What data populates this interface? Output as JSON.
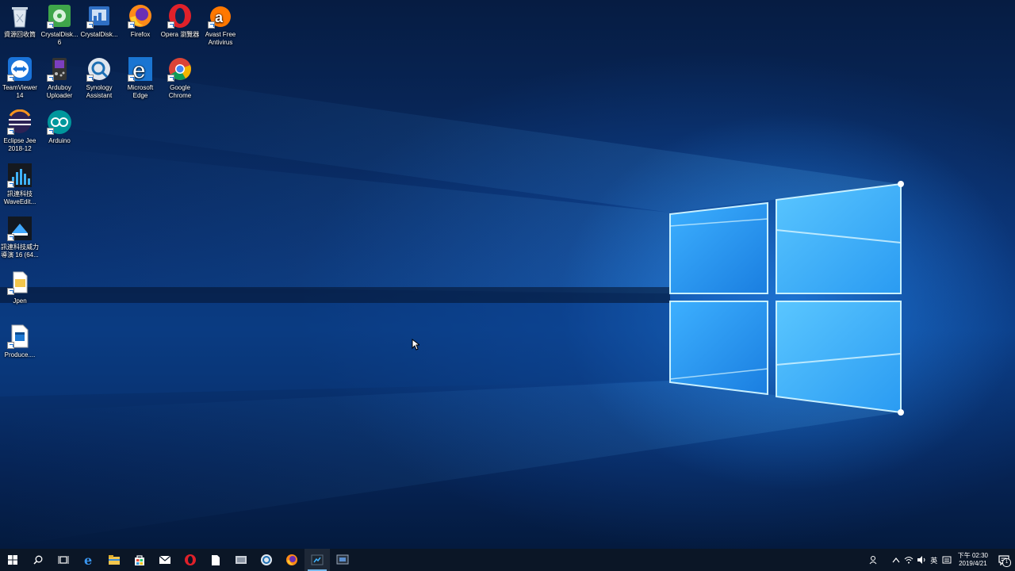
{
  "desktop": {
    "icons": [
      {
        "label": "資源回收筒",
        "icon": "recycle-bin-icon"
      },
      {
        "label": "CrystalDisk... 6",
        "icon": "crystaldiskinfo-icon"
      },
      {
        "label": "CrystalDisk...",
        "icon": "crystaldiskmark-icon"
      },
      {
        "label": "Firefox",
        "icon": "firefox-icon"
      },
      {
        "label": "Opera 瀏覽器",
        "icon": "opera-icon"
      },
      {
        "label": "Avast Free Antivirus",
        "icon": "avast-icon"
      },
      {
        "label": "TeamViewer 14",
        "icon": "teamviewer-icon"
      },
      {
        "label": "Arduboy Uploader",
        "icon": "arduboy-icon"
      },
      {
        "label": "Synology Assistant",
        "icon": "synology-icon"
      },
      {
        "label": "Microsoft Edge",
        "icon": "edge-icon"
      },
      {
        "label": "Google Chrome",
        "icon": "chrome-icon"
      },
      {
        "label": "Eclipse Jee 2018-12",
        "icon": "eclipse-icon"
      },
      {
        "label": "Arduino",
        "icon": "arduino-icon"
      },
      {
        "label": "訊連科技 WaveEdit...",
        "icon": "waveeditor-icon"
      },
      {
        "label": "訊連科技威力導演 16 (64...",
        "icon": "powerdirector-icon"
      },
      {
        "label": "Jpen",
        "icon": "folder-icon"
      },
      {
        "label": "Produce....",
        "icon": "video-file-icon"
      }
    ]
  },
  "taskbar": {
    "items": [
      {
        "name": "start-button",
        "icon": "windows-logo-icon"
      },
      {
        "name": "search-button",
        "icon": "search-icon"
      },
      {
        "name": "task-view-button",
        "icon": "task-view-icon"
      },
      {
        "name": "taskbar-edge",
        "icon": "edge-icon"
      },
      {
        "name": "taskbar-file-explorer",
        "icon": "folder-icon"
      },
      {
        "name": "taskbar-store",
        "icon": "store-icon"
      },
      {
        "name": "taskbar-mail",
        "icon": "mail-icon"
      },
      {
        "name": "taskbar-opera",
        "icon": "opera-icon"
      },
      {
        "name": "taskbar-notepad",
        "icon": "document-icon"
      },
      {
        "name": "taskbar-app-grey",
        "icon": "app-icon"
      },
      {
        "name": "taskbar-synology",
        "icon": "synology-icon"
      },
      {
        "name": "taskbar-firefox",
        "icon": "firefox-icon"
      },
      {
        "name": "taskbar-powerdirector",
        "icon": "powerdirector-icon"
      },
      {
        "name": "taskbar-capture",
        "icon": "screen-capture-icon"
      }
    ],
    "tray": {
      "input_method": "英",
      "time": "下午 02:30",
      "date": "2019/4/21",
      "notification_count": "1"
    }
  },
  "colors": {
    "taskbar_bg": "#0b1626",
    "accent": "#76b9ed",
    "wallpaper_glow": "#3aa0ff"
  }
}
